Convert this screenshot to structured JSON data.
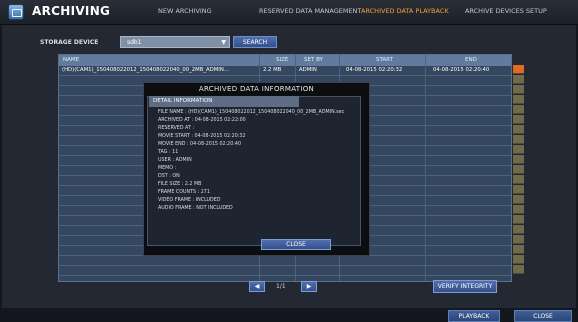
{
  "header": {
    "app_title": "ARCHIVING",
    "tabs": [
      {
        "label": "NEW ARCHIVING"
      },
      {
        "label": "RESERVED DATA MANAGEMENT"
      },
      {
        "label": "ARCHIVED DATA PLAYBACK",
        "active": true
      },
      {
        "label": "ARCHIVE DEVICES SETUP"
      }
    ]
  },
  "storage": {
    "label": "STORAGE DEVICE",
    "value": "sdb1",
    "search_label": "SEARCH"
  },
  "table": {
    "columns": [
      "NAME",
      "SIZE",
      "SET BY",
      "START",
      "END"
    ],
    "rows": [
      {
        "name": "(HD)(CAM1)_150408022012_150408022040_00_2MB_ADMIN...",
        "size": "2.2 MB",
        "set_by": "ADMIN",
        "start": "04-08-2015 02:20:32",
        "end": "04-08-2015 02:20:40"
      }
    ]
  },
  "pager": {
    "prev": "◀",
    "page": "1/1",
    "next": "▶"
  },
  "verify_label": "VERIFY INTEGRITY",
  "bottom": {
    "playback": "PLAYBACK",
    "close": "CLOSE"
  },
  "dialog": {
    "title": "ARCHIVED DATA INFORMATION",
    "detail_header": "DETAIL INFORMATION",
    "lines": [
      "FILE NAME : (HD)(CAM1)_150408022012_150408022040_00_2MB_ADMIN.sec",
      "ARCHIVED AT : 04-08-2015 02:22:00",
      "RESERVED AT :",
      "MOVIE START : 04-08-2015 02:20:32",
      "MOVIE END : 04-08-2015 02:20:40",
      "TAG : 11",
      "USER : ADMIN",
      "MEMO :",
      "DST : ON",
      "FILE SIZE : 2.2 MB",
      "FRAME COUNTS : 271",
      "VIDEO FRAME : INCLUDED",
      "AUDIO FRAME : NOT INCLUDED"
    ],
    "close_label": "CLOSE"
  }
}
